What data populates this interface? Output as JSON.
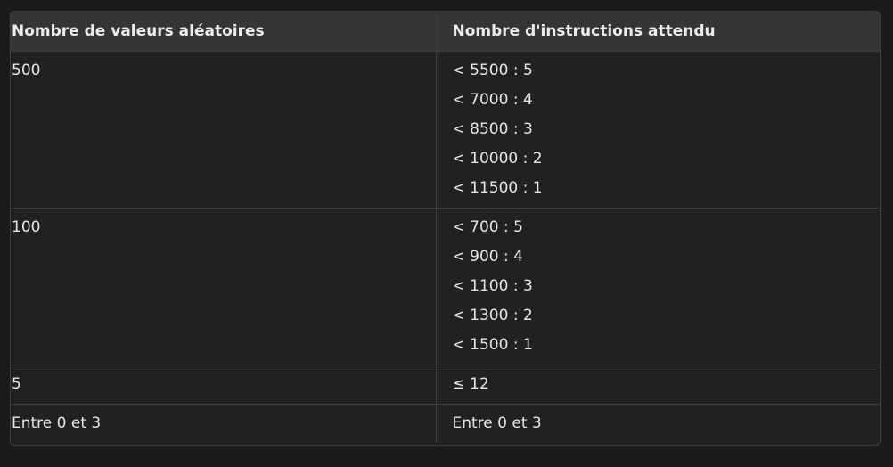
{
  "table": {
    "headers": [
      "Nombre de valeurs aléatoires",
      "Nombre d'instructions attendu"
    ],
    "rows": [
      {
        "count": "500",
        "expected": [
          "< 5500 : 5",
          "< 7000 : 4",
          "< 8500 : 3",
          "< 10000 : 2",
          "< 11500 : 1"
        ]
      },
      {
        "count": "100",
        "expected": [
          "< 700 : 5",
          "< 900 : 4",
          "< 1100 : 3",
          "< 1300 : 2",
          "< 1500 : 1"
        ]
      },
      {
        "count": "5",
        "expected": [
          "≤ 12"
        ]
      },
      {
        "count": "Entre 0 et 3",
        "expected": [
          "Entre 0 et 3"
        ]
      }
    ]
  }
}
